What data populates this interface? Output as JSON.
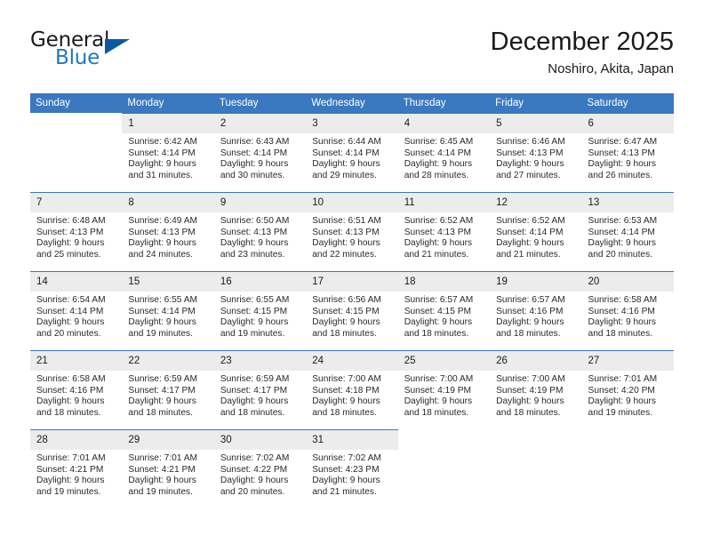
{
  "brand": {
    "word1": "General",
    "word2": "Blue",
    "triangle_color": "#0b5aa0",
    "blue_color": "#1e77c4"
  },
  "header": {
    "month_title": "December 2025",
    "location": "Noshiro, Akita, Japan"
  },
  "theme": {
    "header_bg": "#3a78bf",
    "daynum_bg": "#ececec",
    "cell_bg": "#ffffff"
  },
  "calendar": {
    "weekday_headers": [
      "Sunday",
      "Monday",
      "Tuesday",
      "Wednesday",
      "Thursday",
      "Friday",
      "Saturday"
    ],
    "weeks": [
      [
        {
          "day": "",
          "sunrise": "",
          "sunset": "",
          "daylight_line1": "",
          "daylight_line2": ""
        },
        {
          "day": "1",
          "sunrise": "Sunrise: 6:42 AM",
          "sunset": "Sunset: 4:14 PM",
          "daylight_line1": "Daylight: 9 hours",
          "daylight_line2": "and 31 minutes."
        },
        {
          "day": "2",
          "sunrise": "Sunrise: 6:43 AM",
          "sunset": "Sunset: 4:14 PM",
          "daylight_line1": "Daylight: 9 hours",
          "daylight_line2": "and 30 minutes."
        },
        {
          "day": "3",
          "sunrise": "Sunrise: 6:44 AM",
          "sunset": "Sunset: 4:14 PM",
          "daylight_line1": "Daylight: 9 hours",
          "daylight_line2": "and 29 minutes."
        },
        {
          "day": "4",
          "sunrise": "Sunrise: 6:45 AM",
          "sunset": "Sunset: 4:14 PM",
          "daylight_line1": "Daylight: 9 hours",
          "daylight_line2": "and 28 minutes."
        },
        {
          "day": "5",
          "sunrise": "Sunrise: 6:46 AM",
          "sunset": "Sunset: 4:13 PM",
          "daylight_line1": "Daylight: 9 hours",
          "daylight_line2": "and 27 minutes."
        },
        {
          "day": "6",
          "sunrise": "Sunrise: 6:47 AM",
          "sunset": "Sunset: 4:13 PM",
          "daylight_line1": "Daylight: 9 hours",
          "daylight_line2": "and 26 minutes."
        }
      ],
      [
        {
          "day": "7",
          "sunrise": "Sunrise: 6:48 AM",
          "sunset": "Sunset: 4:13 PM",
          "daylight_line1": "Daylight: 9 hours",
          "daylight_line2": "and 25 minutes."
        },
        {
          "day": "8",
          "sunrise": "Sunrise: 6:49 AM",
          "sunset": "Sunset: 4:13 PM",
          "daylight_line1": "Daylight: 9 hours",
          "daylight_line2": "and 24 minutes."
        },
        {
          "day": "9",
          "sunrise": "Sunrise: 6:50 AM",
          "sunset": "Sunset: 4:13 PM",
          "daylight_line1": "Daylight: 9 hours",
          "daylight_line2": "and 23 minutes."
        },
        {
          "day": "10",
          "sunrise": "Sunrise: 6:51 AM",
          "sunset": "Sunset: 4:13 PM",
          "daylight_line1": "Daylight: 9 hours",
          "daylight_line2": "and 22 minutes."
        },
        {
          "day": "11",
          "sunrise": "Sunrise: 6:52 AM",
          "sunset": "Sunset: 4:13 PM",
          "daylight_line1": "Daylight: 9 hours",
          "daylight_line2": "and 21 minutes."
        },
        {
          "day": "12",
          "sunrise": "Sunrise: 6:52 AM",
          "sunset": "Sunset: 4:14 PM",
          "daylight_line1": "Daylight: 9 hours",
          "daylight_line2": "and 21 minutes."
        },
        {
          "day": "13",
          "sunrise": "Sunrise: 6:53 AM",
          "sunset": "Sunset: 4:14 PM",
          "daylight_line1": "Daylight: 9 hours",
          "daylight_line2": "and 20 minutes."
        }
      ],
      [
        {
          "day": "14",
          "sunrise": "Sunrise: 6:54 AM",
          "sunset": "Sunset: 4:14 PM",
          "daylight_line1": "Daylight: 9 hours",
          "daylight_line2": "and 20 minutes."
        },
        {
          "day": "15",
          "sunrise": "Sunrise: 6:55 AM",
          "sunset": "Sunset: 4:14 PM",
          "daylight_line1": "Daylight: 9 hours",
          "daylight_line2": "and 19 minutes."
        },
        {
          "day": "16",
          "sunrise": "Sunrise: 6:55 AM",
          "sunset": "Sunset: 4:15 PM",
          "daylight_line1": "Daylight: 9 hours",
          "daylight_line2": "and 19 minutes."
        },
        {
          "day": "17",
          "sunrise": "Sunrise: 6:56 AM",
          "sunset": "Sunset: 4:15 PM",
          "daylight_line1": "Daylight: 9 hours",
          "daylight_line2": "and 18 minutes."
        },
        {
          "day": "18",
          "sunrise": "Sunrise: 6:57 AM",
          "sunset": "Sunset: 4:15 PM",
          "daylight_line1": "Daylight: 9 hours",
          "daylight_line2": "and 18 minutes."
        },
        {
          "day": "19",
          "sunrise": "Sunrise: 6:57 AM",
          "sunset": "Sunset: 4:16 PM",
          "daylight_line1": "Daylight: 9 hours",
          "daylight_line2": "and 18 minutes."
        },
        {
          "day": "20",
          "sunrise": "Sunrise: 6:58 AM",
          "sunset": "Sunset: 4:16 PM",
          "daylight_line1": "Daylight: 9 hours",
          "daylight_line2": "and 18 minutes."
        }
      ],
      [
        {
          "day": "21",
          "sunrise": "Sunrise: 6:58 AM",
          "sunset": "Sunset: 4:16 PM",
          "daylight_line1": "Daylight: 9 hours",
          "daylight_line2": "and 18 minutes."
        },
        {
          "day": "22",
          "sunrise": "Sunrise: 6:59 AM",
          "sunset": "Sunset: 4:17 PM",
          "daylight_line1": "Daylight: 9 hours",
          "daylight_line2": "and 18 minutes."
        },
        {
          "day": "23",
          "sunrise": "Sunrise: 6:59 AM",
          "sunset": "Sunset: 4:17 PM",
          "daylight_line1": "Daylight: 9 hours",
          "daylight_line2": "and 18 minutes."
        },
        {
          "day": "24",
          "sunrise": "Sunrise: 7:00 AM",
          "sunset": "Sunset: 4:18 PM",
          "daylight_line1": "Daylight: 9 hours",
          "daylight_line2": "and 18 minutes."
        },
        {
          "day": "25",
          "sunrise": "Sunrise: 7:00 AM",
          "sunset": "Sunset: 4:19 PM",
          "daylight_line1": "Daylight: 9 hours",
          "daylight_line2": "and 18 minutes."
        },
        {
          "day": "26",
          "sunrise": "Sunrise: 7:00 AM",
          "sunset": "Sunset: 4:19 PM",
          "daylight_line1": "Daylight: 9 hours",
          "daylight_line2": "and 18 minutes."
        },
        {
          "day": "27",
          "sunrise": "Sunrise: 7:01 AM",
          "sunset": "Sunset: 4:20 PM",
          "daylight_line1": "Daylight: 9 hours",
          "daylight_line2": "and 19 minutes."
        }
      ],
      [
        {
          "day": "28",
          "sunrise": "Sunrise: 7:01 AM",
          "sunset": "Sunset: 4:21 PM",
          "daylight_line1": "Daylight: 9 hours",
          "daylight_line2": "and 19 minutes."
        },
        {
          "day": "29",
          "sunrise": "Sunrise: 7:01 AM",
          "sunset": "Sunset: 4:21 PM",
          "daylight_line1": "Daylight: 9 hours",
          "daylight_line2": "and 19 minutes."
        },
        {
          "day": "30",
          "sunrise": "Sunrise: 7:02 AM",
          "sunset": "Sunset: 4:22 PM",
          "daylight_line1": "Daylight: 9 hours",
          "daylight_line2": "and 20 minutes."
        },
        {
          "day": "31",
          "sunrise": "Sunrise: 7:02 AM",
          "sunset": "Sunset: 4:23 PM",
          "daylight_line1": "Daylight: 9 hours",
          "daylight_line2": "and 21 minutes."
        },
        {
          "day": "",
          "sunrise": "",
          "sunset": "",
          "daylight_line1": "",
          "daylight_line2": ""
        },
        {
          "day": "",
          "sunrise": "",
          "sunset": "",
          "daylight_line1": "",
          "daylight_line2": ""
        },
        {
          "day": "",
          "sunrise": "",
          "sunset": "",
          "daylight_line1": "",
          "daylight_line2": ""
        }
      ]
    ]
  }
}
